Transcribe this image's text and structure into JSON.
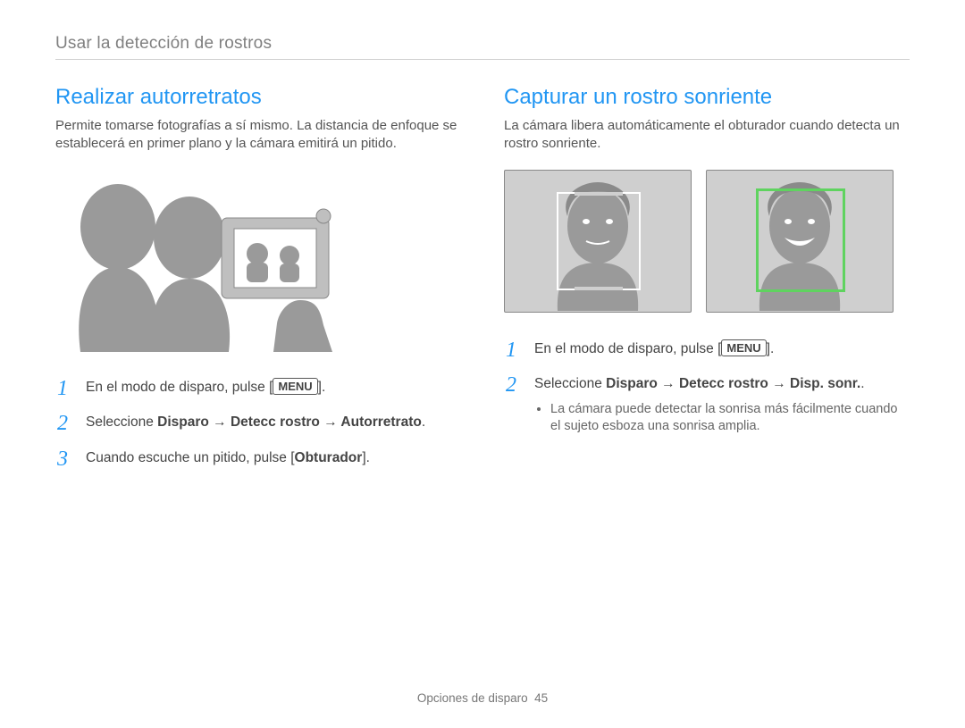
{
  "breadcrumb": "Usar la detección de rostros",
  "left": {
    "title": "Realizar autorretratos",
    "intro": "Permite tomarse fotografías a sí mismo. La distancia de enfoque se establecerá en primer plano y la cámara emitirá un pitido.",
    "steps": {
      "s1_pre": "En el modo de disparo, pulse [",
      "s1_menu": "MENU",
      "s1_post": "].",
      "s2_pre": "Seleccione ",
      "s2_bold": "Disparo → Detecc rostro → Autorretrato",
      "s2_post": ".",
      "s3_pre": "Cuando escuche un pitido, pulse [",
      "s3_bold": "Obturador",
      "s3_post": "]."
    }
  },
  "right": {
    "title": "Capturar un rostro sonriente",
    "intro": "La cámara libera automáticamente el obturador cuando detecta un rostro sonriente.",
    "steps": {
      "s1_pre": "En el modo de disparo, pulse [",
      "s1_menu": "MENU",
      "s1_post": "].",
      "s2_pre": "Seleccione ",
      "s2_bold": "Disparo → Detecc rostro → Disp. sonr.",
      "s2_post": ".",
      "bullet1": "La cámara puede detectar la sonrisa más fácilmente cuando el sujeto esboza una sonrisa amplia."
    }
  },
  "footer": {
    "section": "Opciones de disparo",
    "page": "45"
  }
}
